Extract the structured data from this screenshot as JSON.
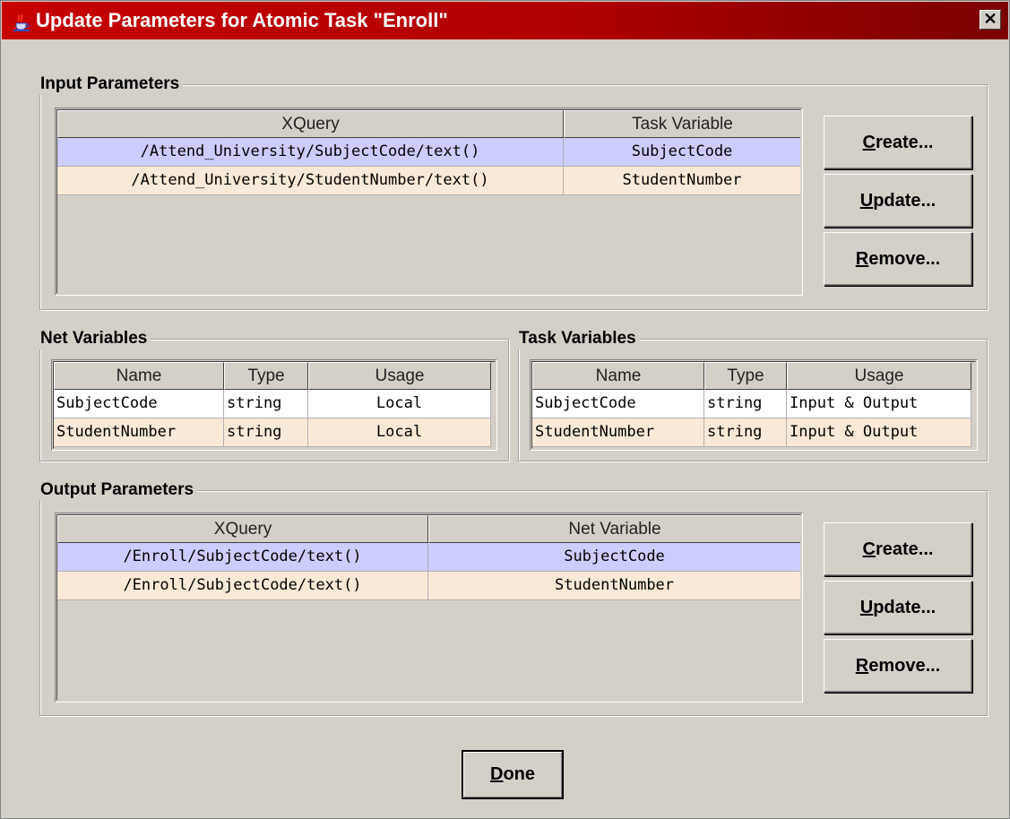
{
  "window": {
    "title": "Update Parameters for Atomic Task \"Enroll\"",
    "close_glyph": "✕"
  },
  "input_parameters": {
    "title": "Input Parameters",
    "columns": [
      "XQuery",
      "Task Variable"
    ],
    "rows": [
      [
        "/Attend_University/SubjectCode/text()",
        "SubjectCode"
      ],
      [
        "/Attend_University/StudentNumber/text()",
        "StudentNumber"
      ]
    ],
    "buttons": {
      "create": "reate...",
      "create_mnemonic": "C",
      "update": "pdate...",
      "update_mnemonic": "U",
      "remove": "emove...",
      "remove_mnemonic": "R"
    }
  },
  "net_variables": {
    "title": "Net Variables",
    "columns": [
      "Name",
      "Type",
      "Usage"
    ],
    "rows": [
      [
        "SubjectCode",
        "string",
        "Local"
      ],
      [
        "StudentNumber",
        "string",
        "Local"
      ]
    ]
  },
  "task_variables": {
    "title": "Task Variables",
    "columns": [
      "Name",
      "Type",
      "Usage"
    ],
    "rows": [
      [
        "SubjectCode",
        "string",
        "Input & Output"
      ],
      [
        "StudentNumber",
        "string",
        "Input & Output"
      ]
    ]
  },
  "output_parameters": {
    "title": "Output Parameters",
    "columns": [
      "XQuery",
      "Net Variable"
    ],
    "rows": [
      [
        "/Enroll/SubjectCode/text()",
        "SubjectCode"
      ],
      [
        "/Enroll/SubjectCode/text()",
        "StudentNumber"
      ]
    ],
    "buttons": {
      "create": "reate...",
      "create_mnemonic": "C",
      "update": "pdate...",
      "update_mnemonic": "U",
      "remove": "emove...",
      "remove_mnemonic": "R"
    }
  },
  "done_button": {
    "mnemonic": "D",
    "label": "one"
  },
  "colors": {
    "title_bar": "#c50000",
    "selected_row": "#ccccff",
    "alt_row": "#fbe9d7",
    "background": "#d4d0c8"
  }
}
